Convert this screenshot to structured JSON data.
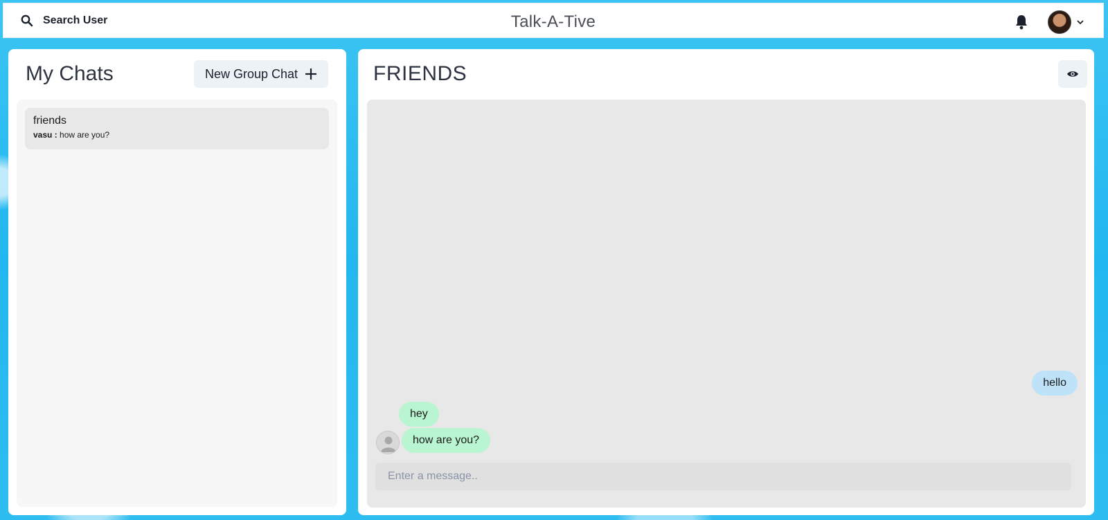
{
  "header": {
    "search_label": "Search User",
    "app_title": "Talk-A-Tive"
  },
  "sidebar": {
    "title": "My Chats",
    "new_group_label": "New Group Chat",
    "chats": [
      {
        "name": "friends",
        "last_sender": "vasu :",
        "last_message": "how are you?"
      }
    ]
  },
  "chat": {
    "title": "FRIENDS",
    "messages": [
      {
        "text": "hello",
        "type": "sent"
      },
      {
        "text": "hey",
        "type": "received"
      },
      {
        "text": "how are you?",
        "type": "received"
      }
    ],
    "input_placeholder": "Enter a message.."
  },
  "icons": {
    "search": "search-icon",
    "bell": "bell-icon",
    "chevron": "chevron-down-icon",
    "plus": "plus-icon",
    "eye": "eye-icon"
  },
  "colors": {
    "sent_bubble": "#bee3f8",
    "received_bubble": "#b9f5d0",
    "background": "#22b7f0"
  }
}
